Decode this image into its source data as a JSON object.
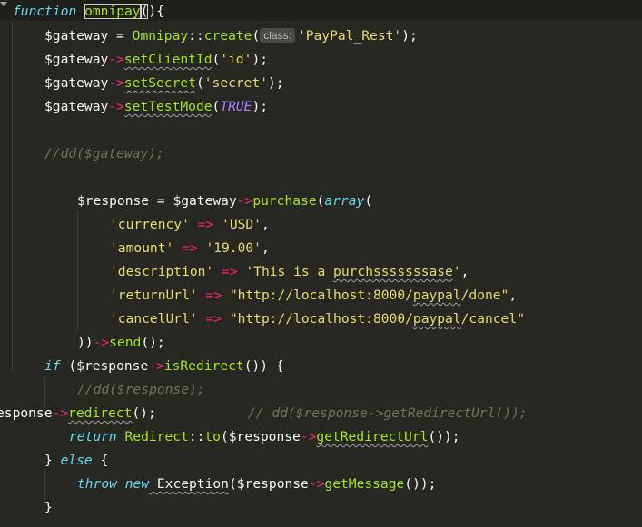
{
  "editor": {
    "colors": {
      "background": "#272822",
      "keyword": "#66d9ef",
      "function": "#a6e22e",
      "string": "#e6db74",
      "operator": "#f92672",
      "comment": "#75715e",
      "constant": "#ae81ff"
    },
    "lines": {
      "l1": {
        "kw": "function",
        "name": "omnipay",
        "paren": "(",
        "rest": "){"
      },
      "l2": {
        "var": "$gateway",
        "eq": " = ",
        "cls": "Omnipay",
        "sep": "::",
        "meth": "create",
        "open": "(",
        "hint": "class:",
        "str": "'PayPal_Rest'",
        "close": ");"
      },
      "l3": {
        "var": "$gateway",
        "arrow": "->",
        "meth": "setClientId",
        "open": "(",
        "str": "'id'",
        "close": ");"
      },
      "l4": {
        "var": "$gateway",
        "arrow": "->",
        "meth": "setSecret",
        "open": "(",
        "str": "'secret'",
        "close": ");"
      },
      "l5": {
        "var": "$gateway",
        "arrow": "->",
        "meth": "setTestMode",
        "open": "(",
        "const": "TRUE",
        "close": ");"
      },
      "l6": {
        "cmt": "//dd($gateway);"
      },
      "l7": {
        "var": "$response",
        "eq": " = ",
        "var2": "$gateway",
        "arrow": "->",
        "meth": "purchase",
        "open": "(",
        "kw": "array",
        "close": "("
      },
      "l8": {
        "key": "'currency'",
        "op": " => ",
        "val": "'USD'",
        "comma": ","
      },
      "l9": {
        "key": "'amount'",
        "op": " => ",
        "val": "'19.00'",
        "comma": ","
      },
      "l10": {
        "key": "'description'",
        "op": " => ",
        "val_a": "'This is a ",
        "val_b": "purchsssssssase",
        "val_c": "'",
        "comma": ","
      },
      "l11": {
        "key": "'returnUrl'",
        "op": " => ",
        "val_a": "\"http://localhost:8000/",
        "val_b": "paypal",
        "val_c": "/done\"",
        "comma": ","
      },
      "l12": {
        "key": "'cancelUrl'",
        "op": " => ",
        "val_a": "\"http://localhost:8000/",
        "val_b": "paypal",
        "val_c": "/cancel\""
      },
      "l13": {
        "pre": "))",
        "arrow": "->",
        "meth": "send",
        "close": "();"
      },
      "l14": {
        "kw": "if",
        "open": " (",
        "var": "$response",
        "arrow": "->",
        "meth": "isRedirect",
        "close": "()) {"
      },
      "l15": {
        "cmt": "//dd($response);"
      },
      "l16": {
        "var": "esponse",
        "arrow": "->",
        "meth": "redirect",
        "close": "();",
        "cmt": "// dd($response->getRedirectUrl());"
      },
      "l17": {
        "kw": "return",
        "cls": " Redirect",
        "sep": "::",
        "meth": "to",
        "open": "(",
        "var": "$response",
        "arrow": "->",
        "meth2": "getRedirectUrl",
        "close": "());"
      },
      "l18": {
        "pre": "} ",
        "kw": "else",
        "post": " {"
      },
      "l19": {
        "kw": "throw",
        "kw2": " new",
        "cls": " Exception",
        "open": "(",
        "var": "$response",
        "arrow": "->",
        "meth": "getMessage",
        "close": "());"
      },
      "l20": {
        "brace": "}"
      }
    }
  }
}
